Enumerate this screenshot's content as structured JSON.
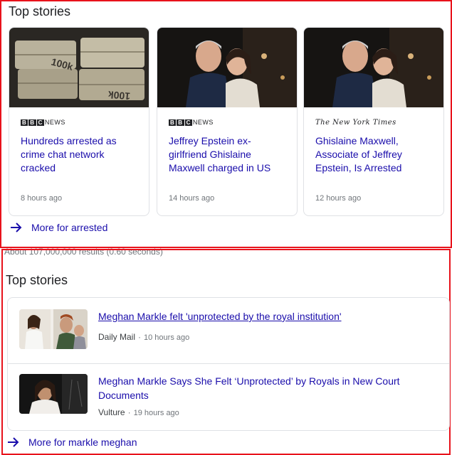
{
  "top_section_1": {
    "title": "Top stories",
    "cards": [
      {
        "source": "BBC NEWS",
        "headline": "Hundreds arrested as crime chat network cracked",
        "time": "8 hours ago"
      },
      {
        "source": "BBC NEWS",
        "headline": "Jeffrey Epstein ex-girlfriend Ghislaine Maxwell charged in US",
        "time": "14 hours ago"
      },
      {
        "source": "The New York Times",
        "headline": "Ghislaine Maxwell, Associate of Jeffrey Epstein, Is Arrested",
        "time": "12 hours ago"
      }
    ],
    "more_link": "More for arrested"
  },
  "results_stats": "About 107,000,000 results (0.60 seconds)",
  "top_section_2": {
    "title": "Top stories",
    "items": [
      {
        "title": "Meghan Markle felt 'unprotected by the royal institution'",
        "source": "Daily Mail",
        "time": "10 hours ago"
      },
      {
        "title": "Meghan Markle Says She Felt ‘Unprotected’ by Royals in New Court Documents",
        "source": "Vulture",
        "time": "19 hours ago"
      }
    ],
    "more_link": "More for markle meghan"
  },
  "colors": {
    "link": "#1a0dab",
    "highlight_border": "#e8121b",
    "meta": "#70757a"
  }
}
